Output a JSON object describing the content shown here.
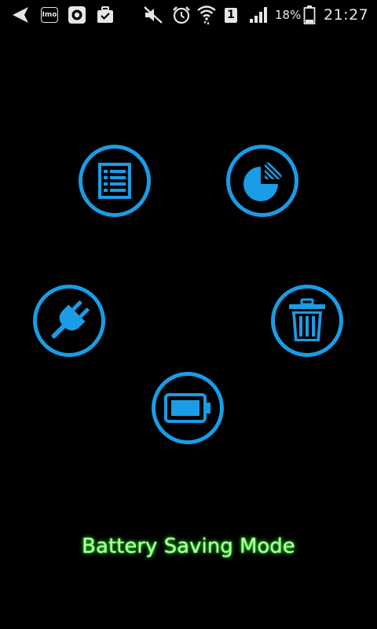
{
  "status_bar": {
    "imo_label": "Imo",
    "sim_badge": "1",
    "battery_percent": "18%",
    "time": "21:27",
    "icons": [
      "back-arrow-icon",
      "imo-icon",
      "target-icon",
      "briefcase-icon",
      "mute-icon",
      "alarm-icon",
      "wifi-icon",
      "sim-1-icon",
      "signal-icon",
      "battery-icon"
    ]
  },
  "buttons": [
    {
      "id": "task-list",
      "icon": "list-icon"
    },
    {
      "id": "usage-stats",
      "icon": "pie-chart-icon"
    },
    {
      "id": "charging",
      "icon": "plug-icon"
    },
    {
      "id": "cleaner",
      "icon": "trash-icon"
    },
    {
      "id": "battery",
      "icon": "battery-icon"
    }
  ],
  "mode": {
    "label": "Battery Saving Mode"
  },
  "colors": {
    "accent_blue": "#1a9ce6",
    "label_green": "#b9ffa8",
    "background": "#000000",
    "status_text": "#e6e6e6"
  }
}
